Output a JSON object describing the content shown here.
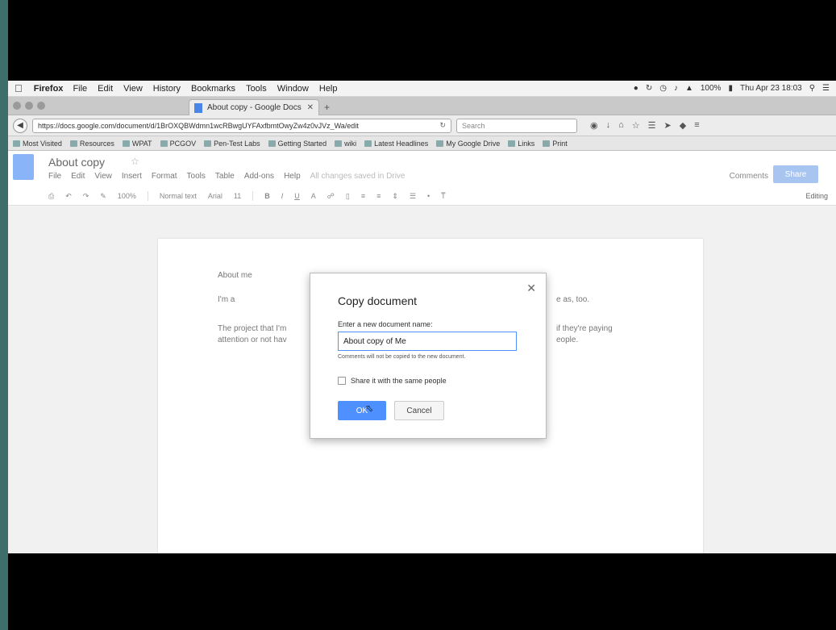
{
  "menubar": {
    "app": "Firefox",
    "items": [
      "File",
      "Edit",
      "View",
      "History",
      "Bookmarks",
      "Tools",
      "Window",
      "Help"
    ],
    "battery": "100%",
    "clock": "Thu Apr 23  18:03"
  },
  "tab": {
    "title": "About copy - Google Docs"
  },
  "navbar": {
    "url": "https://docs.google.com/document/d/1BrOXQBWdmn1wcRBwgUYFAxfbmtOwyZw4z0vJVz_Wa/edit",
    "search_placeholder": "Search"
  },
  "bookmarks": [
    "Most Visited",
    "Resources",
    "WPAT",
    "PCGOV",
    "Pen-Test Labs",
    "Getting Started",
    "wiki",
    "Latest Headlines",
    "My Google Drive",
    "Links",
    "Print"
  ],
  "docs": {
    "title": "About copy",
    "menu": [
      "File",
      "Edit",
      "View",
      "Insert",
      "Format",
      "Tools",
      "Table",
      "Add-ons",
      "Help"
    ],
    "edit_note": "All changes saved in Drive",
    "comments": "Comments",
    "share": "Share",
    "toolbar": {
      "zoom": "100%",
      "style": "Normal text",
      "font": "Arial",
      "size": "11",
      "mode": "Editing"
    }
  },
  "document": {
    "heading": "About me",
    "line1_start": "I'm a",
    "line1_end": "e as, too.",
    "line2_start": "The project that I'm",
    "line2_end": "if they're paying",
    "line3_start": "attention or not hav",
    "line3_end": "eople."
  },
  "dialog": {
    "title": "Copy document",
    "field_label": "Enter a new document name:",
    "input_value": "About copy of Me",
    "hint": "Comments will not be copied to the new document.",
    "share_label": "Share it with the same people",
    "ok_label": "OK",
    "cancel_label": "Cancel"
  }
}
